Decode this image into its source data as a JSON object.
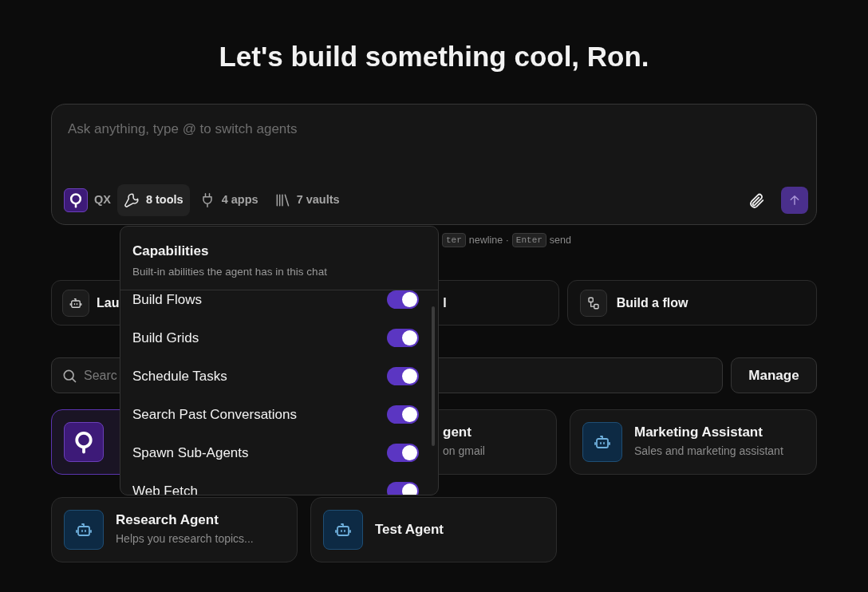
{
  "title": "Let's build something cool, Ron.",
  "composer": {
    "placeholder": "Ask anything, type @ to switch agents",
    "agent": "QX",
    "chips": [
      {
        "kind": "tools",
        "label": "8 tools",
        "selected": true
      },
      {
        "kind": "apps",
        "label": "4 apps",
        "selected": false
      },
      {
        "kind": "vaults",
        "label": "7 vaults",
        "selected": false
      }
    ]
  },
  "hint": [
    {
      "kind": "key",
      "text": "ter"
    },
    {
      "kind": "text",
      "text": "newline ·"
    },
    {
      "kind": "key",
      "text": "Enter"
    },
    {
      "kind": "text",
      "text": "send"
    }
  ],
  "quick_actions": [
    {
      "label": "Lau",
      "kind": "robot"
    },
    {
      "label": "l",
      "kind": "covered"
    },
    {
      "label": "Build a flow",
      "kind": "flow"
    }
  ],
  "search": {
    "placeholder": "Searc"
  },
  "manage_button": "Manage",
  "agents": [
    {
      "kind": "qx",
      "selected": true
    },
    {
      "title": "gent",
      "subtitle": "on gmail",
      "kind": "covered",
      "selected": false
    },
    {
      "title": "Marketing Assistant",
      "subtitle": "Sales and marketing assistant",
      "kind": "robot",
      "selected": false
    },
    {
      "title": "Research Agent",
      "subtitle": "Helps you research topics...",
      "kind": "robot",
      "selected": false
    },
    {
      "title": "Test Agent",
      "kind": "robot",
      "selected": false
    }
  ],
  "capabilities": {
    "title": "Capabilities",
    "subtitle": "Built-in abilities the agent has in this chat",
    "items": [
      {
        "label": "Build Flows",
        "on": true
      },
      {
        "label": "Build Grids",
        "on": true
      },
      {
        "label": "Schedule Tasks",
        "on": true
      },
      {
        "label": "Search Past Conversations",
        "on": true
      },
      {
        "label": "Spawn Sub-Agents",
        "on": true
      },
      {
        "label": "Web Fetch",
        "on": true
      }
    ]
  }
}
